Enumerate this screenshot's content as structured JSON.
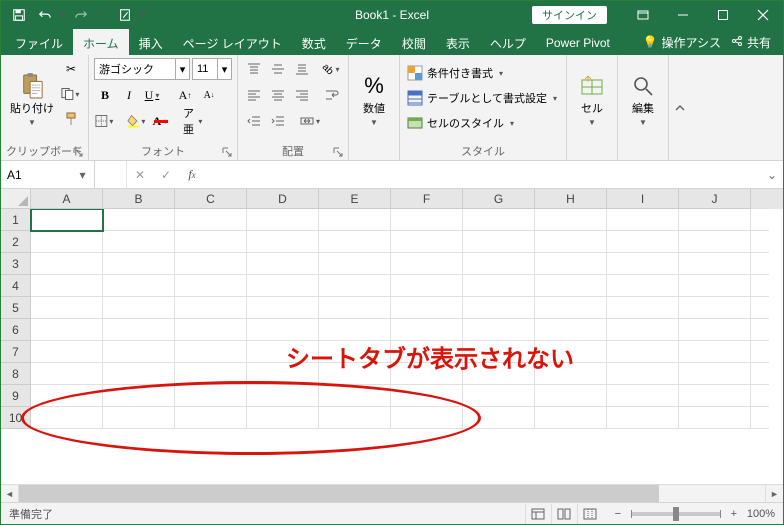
{
  "titlebar": {
    "title": "Book1 - Excel",
    "signin": "サインイン"
  },
  "tabs": {
    "file": "ファイル",
    "home": "ホーム",
    "insert": "挿入",
    "pagelayout": "ページ レイアウト",
    "formulas": "数式",
    "data": "データ",
    "review": "校閲",
    "view": "表示",
    "help": "ヘルプ",
    "powerpivot": "Power Pivot",
    "tellme": "操作アシス",
    "share": "共有"
  },
  "ribbon": {
    "clipboard": {
      "paste": "貼り付け",
      "group": "クリップボード"
    },
    "font": {
      "name": "游ゴシック",
      "size": "11",
      "group": "フォント"
    },
    "alignment": {
      "group": "配置"
    },
    "number": {
      "label": "数値",
      "group": "数値"
    },
    "styles": {
      "cond": "条件付き書式",
      "table": "テーブルとして書式設定",
      "cell": "セルのスタイル",
      "group": "スタイル"
    },
    "cells": {
      "label": "セル"
    },
    "editing": {
      "label": "編集"
    }
  },
  "formulabar": {
    "namebox": "A1",
    "formula": ""
  },
  "grid": {
    "cols": [
      "A",
      "B",
      "C",
      "D",
      "E",
      "F",
      "G",
      "H",
      "I",
      "J"
    ],
    "rows": [
      "1",
      "2",
      "3",
      "4",
      "5",
      "6",
      "7",
      "8",
      "9",
      "10"
    ]
  },
  "annotation": {
    "text": "シートタブが表示されない"
  },
  "status": {
    "ready": "準備完了",
    "zoom": "100%"
  }
}
